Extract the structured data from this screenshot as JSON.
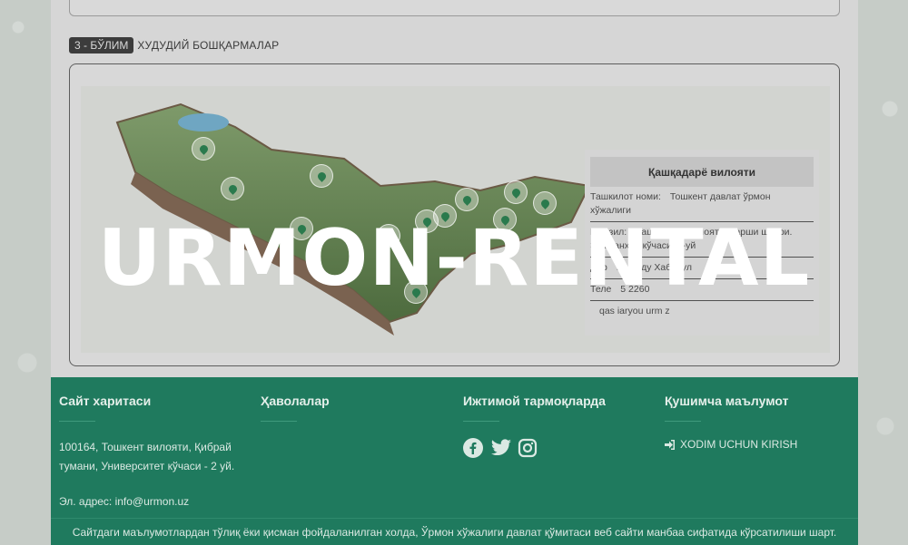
{
  "section": {
    "badge": "3 - БЎЛИМ",
    "title": "ХУДУДИЙ БОШҚАРМАЛАР"
  },
  "info_panel": {
    "title": "Қашқадарё вилояти",
    "rows": [
      {
        "key": "Ташкилот номи:",
        "value": "Тошкент давлат ўрмон хўжалиги"
      },
      {
        "key": "Манзил:",
        "value": "Қашқадарё вилояти. Қарши шаҳри. Эски анҳор кўчаси. 4-уй"
      },
      {
        "key": "Дир",
        "value": "Ез   Абду    Хабибул"
      },
      {
        "key": "Теле",
        "value": "5 2260"
      },
      {
        "key": "",
        "value": "qas    iaryou   urm    z"
      }
    ]
  },
  "watermark": "URMON-RENTAL",
  "footer": {
    "col1": {
      "title": "Сайт харитаси",
      "address": "100164, Тошкент вилояти, Қибрай тумани, Университет кўчаси - 2 уй.",
      "email": "Эл. адрес: info@urmon.uz"
    },
    "col2": {
      "title": "Ҳаволалар"
    },
    "col3": {
      "title": "Ижтимой тармоқларда",
      "icons": [
        "facebook-icon",
        "twitter-icon",
        "instagram-icon"
      ]
    },
    "col4": {
      "title": "Қушимча маълумот",
      "login": "XODIM UCHUN KIRISH"
    },
    "bottom": "Сайтдаги маълумотлардан тўлиқ ёки қисман фойдаланилган холда, Ўрмон хўжалиги давлат қўмитаси веб сайти манбаа сифатида кўрсатилиши шарт."
  },
  "colors": {
    "footer_bg": "#1f7a5e",
    "badge_bg": "#3c3c3c"
  }
}
